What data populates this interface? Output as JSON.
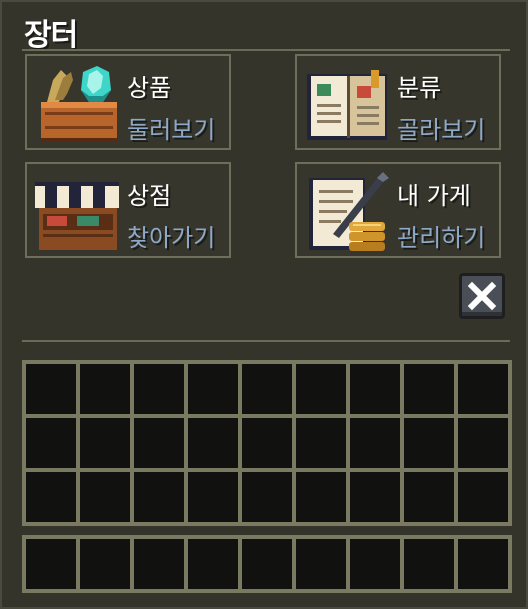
{
  "window": {
    "title": "장터"
  },
  "menu": [
    {
      "line1": "상품",
      "line2": "둘러보기",
      "icon": "diamond-crate-icon"
    },
    {
      "line1": "분류",
      "line2": "골라보기",
      "icon": "open-book-icon"
    },
    {
      "line1": "상점",
      "line2": "찾아가기",
      "icon": "market-stall-icon"
    },
    {
      "line1": "내 가게",
      "line2": "관리하기",
      "icon": "ledger-coins-icon"
    }
  ],
  "close": {
    "icon": "close-icon"
  },
  "inventory": {
    "main_rows": 3,
    "hotbar_rows": 1,
    "columns": 9
  },
  "colors": {
    "accent_subtitle": "#8ea8c8",
    "slot_bg": "#111110",
    "panel_bg": "#34342b"
  }
}
